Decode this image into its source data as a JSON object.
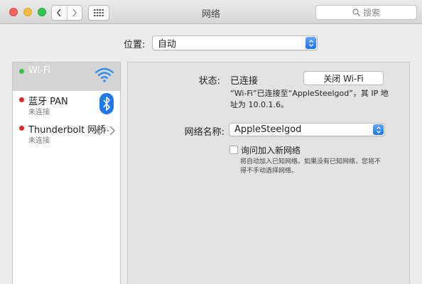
{
  "window": {
    "title": "网络"
  },
  "search": {
    "placeholder": "搜索"
  },
  "location": {
    "label": "位置:",
    "value": "自动"
  },
  "services": [
    {
      "name": "Wi-Fi",
      "status": "",
      "dot_color": "#35c24a",
      "icon": "wifi-icon",
      "selected": true
    },
    {
      "name": "蓝牙 PAN",
      "status": "未连接",
      "dot_color": "#e0272a",
      "icon": "bluetooth-icon",
      "selected": false
    },
    {
      "name": "Thunderbolt 网桥",
      "status": "未连接",
      "dot_color": "#e0272a",
      "icon": "thunderbolt-bridge-icon",
      "selected": false
    }
  ],
  "detail": {
    "status_label": "状态:",
    "status_value": "已连接",
    "turn_off_button": "关闭 Wi-Fi",
    "status_description": "“Wi-Fi”已连接至“AppleSteelgod”，其 IP 地址为 10.0.1.6。",
    "network_name_label": "网络名称:",
    "network_name_value": "AppleSteelgod",
    "ask_join_label": "询问加入新网络",
    "ask_join_checked": false,
    "ask_join_note": "将自动加入已知网络。如果没有已知网络，您将不得不手动选择网络。"
  },
  "colors": {
    "accent": "#1a74ec",
    "selection": "#d4d4d4",
    "connected": "#35c24a",
    "disconnected": "#e0272a"
  }
}
